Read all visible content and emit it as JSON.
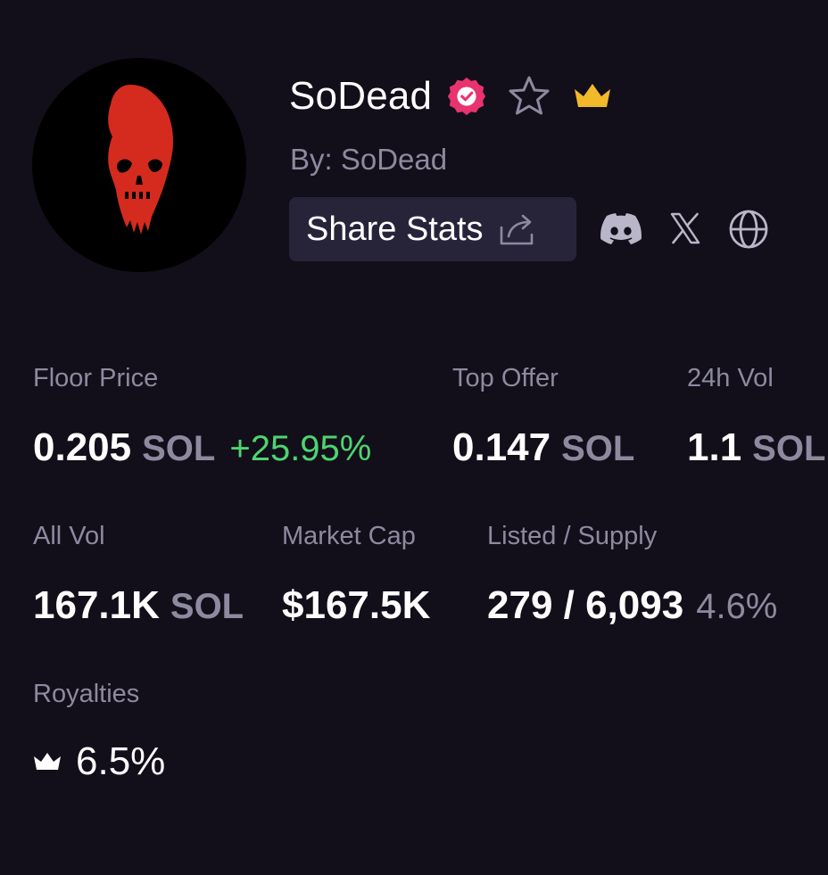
{
  "header": {
    "name": "SoDead",
    "by_line": "By: SoDead",
    "share_label": "Share Stats",
    "icons": [
      "verified-icon",
      "star-icon",
      "crown-icon",
      "share-icon",
      "discord-icon",
      "x-icon",
      "globe-icon"
    ]
  },
  "colors": {
    "background": "#120f1a",
    "button_background": "#27243a",
    "muted_text": "#8d8aa0",
    "positive": "#4ed46f",
    "verified": "#e8336f",
    "crown": "#f2b92b",
    "avatar_skull": "#d52b1e"
  },
  "stats": {
    "floor_price": {
      "label": "Floor Price",
      "value": "0.205",
      "unit": "SOL",
      "change": "+25.95%"
    },
    "top_offer": {
      "label": "Top Offer",
      "value": "0.147",
      "unit": "SOL"
    },
    "vol_24h": {
      "label": "24h Vol",
      "value": "1.1",
      "unit": "SOL"
    },
    "all_vol": {
      "label": "All Vol",
      "value": "167.1K",
      "unit": "SOL"
    },
    "market_cap": {
      "label": "Market Cap",
      "value": "$167.5K"
    },
    "listed_supply": {
      "label": "Listed / Supply",
      "value": "279 / 6,093",
      "percent": "4.6%"
    },
    "royalties": {
      "label": "Royalties",
      "value": "6.5%"
    }
  }
}
